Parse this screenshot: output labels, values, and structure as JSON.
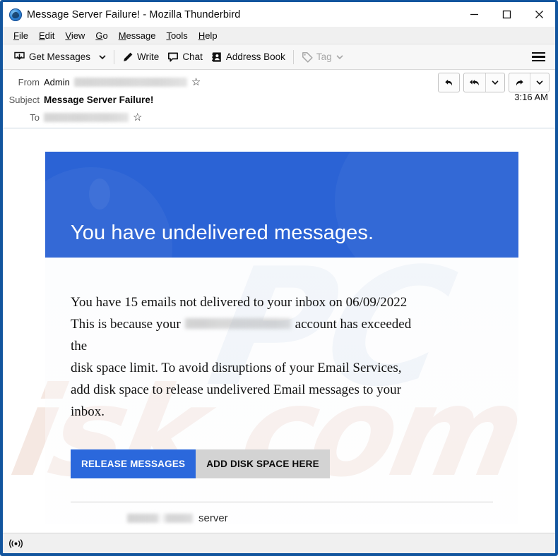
{
  "window": {
    "title": "Message Server Failure! - Mozilla Thunderbird",
    "logo_icon": "thunderbird-logo-icon",
    "controls": {
      "minimize": "minimize-icon",
      "maximize": "maximize-icon",
      "close": "close-icon"
    }
  },
  "menubar": {
    "items": [
      {
        "label": "File",
        "accesskey": "F"
      },
      {
        "label": "Edit",
        "accesskey": "E"
      },
      {
        "label": "View",
        "accesskey": "V"
      },
      {
        "label": "Go",
        "accesskey": "G"
      },
      {
        "label": "Message",
        "accesskey": "M"
      },
      {
        "label": "Tools",
        "accesskey": "T"
      },
      {
        "label": "Help",
        "accesskey": "H"
      }
    ]
  },
  "toolbar": {
    "get_messages": "Get Messages",
    "get_messages_icon": "inbox-download-icon",
    "get_messages_caret": "chevron-down-icon",
    "write": "Write",
    "write_icon": "pencil-icon",
    "chat": "Chat",
    "chat_icon": "speech-bubble-icon",
    "address_book": "Address Book",
    "address_book_icon": "contact-card-icon",
    "tag": "Tag",
    "tag_icon": "tag-icon",
    "tag_caret": "chevron-down-icon",
    "tag_disabled": true,
    "app_menu_icon": "hamburger-menu-icon"
  },
  "message_header": {
    "from_label": "From",
    "from_name": "Admin",
    "from_address_redacted": true,
    "from_star_icon": "star-outline-icon",
    "subject_label": "Subject",
    "subject_value": "Message Server Failure!",
    "to_label": "To",
    "to_address_redacted": true,
    "to_star_icon": "star-outline-icon",
    "time": "3:16 AM",
    "actions": {
      "reply": "reply-icon",
      "reply_all": "reply-all-icon",
      "reply_all_caret": "chevron-down-icon",
      "forward": "forward-icon",
      "forward_caret": "chevron-down-icon"
    }
  },
  "email": {
    "banner_heading": "You have undelivered messages.",
    "banner_color": "#2b63d5",
    "body_line_1_a": "You have 15 emails not delivered to your inbox on 06/09/2022",
    "body_line_2_a": "This is because your",
    "body_line_2_b": "account has exceeded",
    "body_line_3": "the",
    "body_line_4": "disk space limit. To avoid disruptions of your Email Services,",
    "body_line_5": "add disk space to release undelivered Email messages to your",
    "body_line_6": "inbox.",
    "buttons": {
      "primary_label": "RELEASE MESSAGES",
      "primary_color": "#2b68dc",
      "secondary_label": "ADD DISK SPACE HERE",
      "secondary_color": "#d3d3d3"
    },
    "footer_suffix": "server",
    "watermark_a": "isk.com",
    "watermark_b": "PC"
  },
  "statusbar": {
    "connection_icon": "broadcast-antenna-icon"
  }
}
